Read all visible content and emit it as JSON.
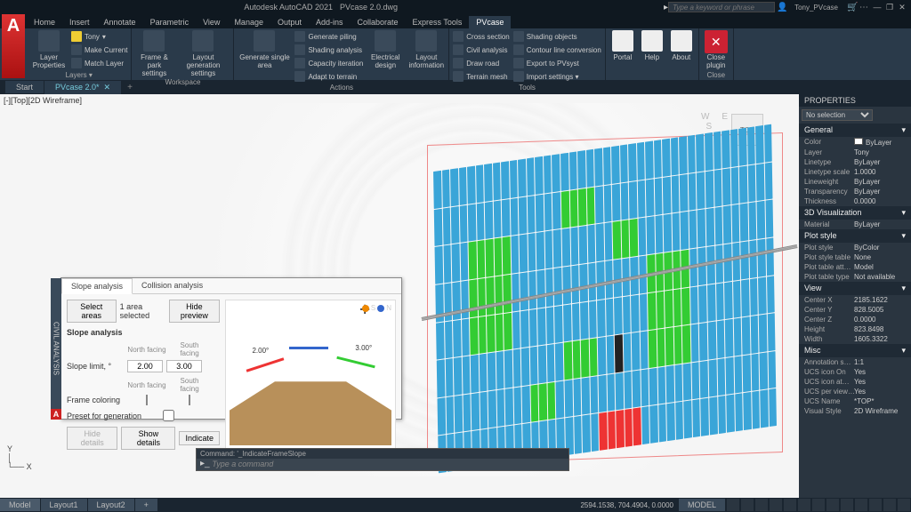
{
  "title": {
    "app": "Autodesk AutoCAD 2021",
    "doc": "PVcase 2.0.dwg"
  },
  "search": {
    "placeholder": "Type a keyword or phrase"
  },
  "user": "Tony_PVcase",
  "menutabs": [
    "Home",
    "Insert",
    "Annotate",
    "Parametric",
    "View",
    "Manage",
    "Output",
    "Add-ins",
    "Collaborate",
    "Express Tools",
    "PVcase"
  ],
  "menutab_active": 10,
  "ribbon": {
    "layers": {
      "label": "Layers ▾",
      "layer_prop": "Layer\nProperties",
      "make_current": "Make Current",
      "match": "Match Layer",
      "combo": "Tony"
    },
    "workspace": {
      "label": "Workspace",
      "fp": "Frame & park\nsettings",
      "lg": "Layout generation\nsettings"
    },
    "actions": {
      "label": "Actions",
      "gsa": "Generate single\narea",
      "gp": "Generate piling",
      "sa": "Shading analysis",
      "ci": "Capacity iteration",
      "at": "Adapt to terrain",
      "ed": "Electrical\ndesign",
      "li": "Layout\ninformation"
    },
    "tools": {
      "label": "Tools",
      "cs": "Cross section",
      "ca": "Civil analysis",
      "dr": "Draw road",
      "tm": "Terrain mesh",
      "so": "Shading objects",
      "clc": "Contour line conversion",
      "ep": "Export to PVsyst",
      "is": "Import settings ▾"
    },
    "right": {
      "portal": "Portal",
      "help": "Help",
      "about": "About",
      "close": "Close\nplugin",
      "close_label": "Close"
    }
  },
  "doctabs": [
    "Start",
    "PVcase 2.0*"
  ],
  "doctab_active": 1,
  "viewlabel": "[-][Top][2D Wireframe]",
  "viewcube": "TOP",
  "dialog": {
    "side": "CIVIL ANALYSIS",
    "tabs": [
      "Slope analysis",
      "Collision analysis"
    ],
    "tab_active": 0,
    "select": "Select areas",
    "selected": "1 area selected",
    "hidepv": "Hide preview",
    "heading": "Slope analysis",
    "slopelimit": "Slope limit, °",
    "nf": "North facing",
    "sf": "South facing",
    "nval": "2.00",
    "sval": "3.00",
    "framecol": "Frame coloring",
    "preset": "Preset for generation",
    "hd": "Hide details",
    "sd": "Show details",
    "ind": "Indicate",
    "deg1": "2.00°",
    "deg2": "3.00°",
    "legend_s": "S",
    "legend_n": "N"
  },
  "cmd": {
    "hist": "Command: '_IndicateFrameSlope",
    "placeholder": "Type a command"
  },
  "layouts": [
    "Model",
    "Layout1",
    "Layout2"
  ],
  "layouts_active": 0,
  "status": {
    "coords": "2594.1538, 704.4904, 0.0000",
    "model": "MODEL"
  },
  "properties": {
    "title": "PROPERTIES",
    "sel": "No selection",
    "groups": [
      {
        "name": "General",
        "rows": [
          {
            "k": "Color",
            "v": "ByLayer",
            "swatch": true
          },
          {
            "k": "Layer",
            "v": "Tony"
          },
          {
            "k": "Linetype",
            "v": "ByLayer"
          },
          {
            "k": "Linetype scale",
            "v": "1.0000"
          },
          {
            "k": "Lineweight",
            "v": "ByLayer"
          },
          {
            "k": "Transparency",
            "v": "ByLayer"
          },
          {
            "k": "Thickness",
            "v": "0.0000"
          }
        ]
      },
      {
        "name": "3D Visualization",
        "rows": [
          {
            "k": "Material",
            "v": "ByLayer"
          }
        ]
      },
      {
        "name": "Plot style",
        "rows": [
          {
            "k": "Plot style",
            "v": "ByColor"
          },
          {
            "k": "Plot style table",
            "v": "None"
          },
          {
            "k": "Plot table att…",
            "v": "Model"
          },
          {
            "k": "Plot table type",
            "v": "Not available"
          }
        ]
      },
      {
        "name": "View",
        "rows": [
          {
            "k": "Center X",
            "v": "2185.1622"
          },
          {
            "k": "Center Y",
            "v": "828.5005"
          },
          {
            "k": "Center Z",
            "v": "0.0000"
          },
          {
            "k": "Height",
            "v": "823.8498"
          },
          {
            "k": "Width",
            "v": "1605.3322"
          }
        ]
      },
      {
        "name": "Misc",
        "rows": [
          {
            "k": "Annotation s…",
            "v": "1:1"
          },
          {
            "k": "UCS icon On",
            "v": "Yes"
          },
          {
            "k": "UCS icon at…",
            "v": "Yes"
          },
          {
            "k": "UCS per view…",
            "v": "Yes"
          },
          {
            "k": "UCS Name",
            "v": "*TOP*"
          },
          {
            "k": "Visual Style",
            "v": "2D Wireframe"
          }
        ]
      }
    ]
  }
}
